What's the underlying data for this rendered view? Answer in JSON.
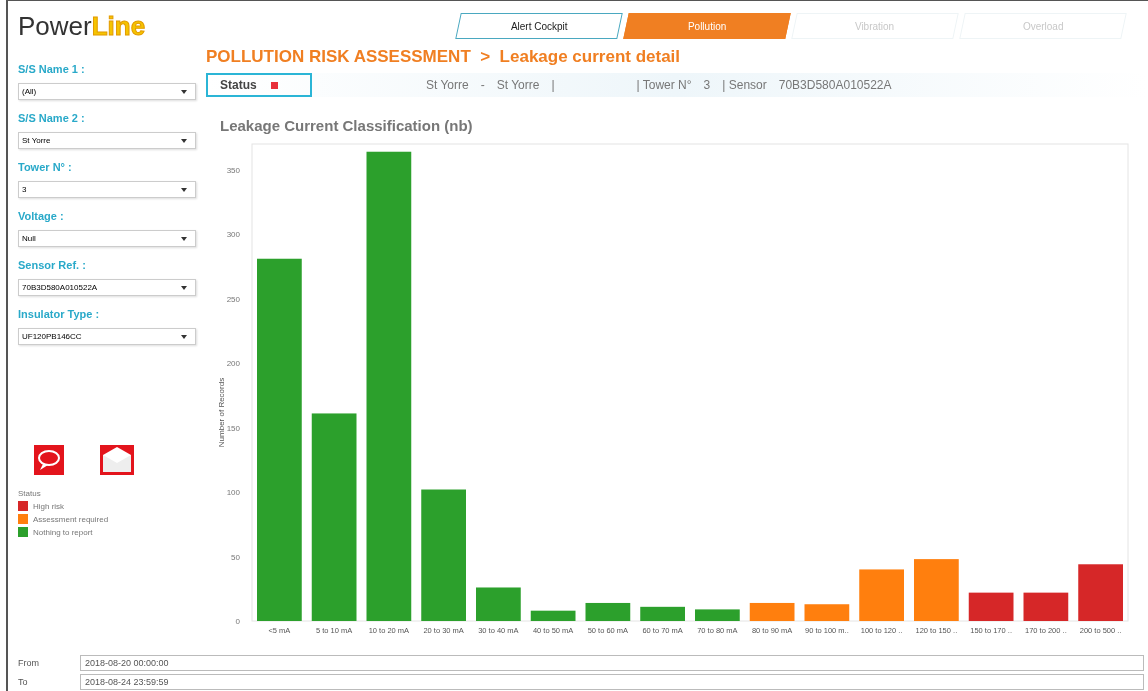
{
  "logo": {
    "part_1": "Power",
    "part_2": "Line"
  },
  "nav_tabs": [
    {
      "label": "Alert Cockpit",
      "selected": false,
      "disabled": false
    },
    {
      "label": "Pollution",
      "selected": true,
      "disabled": false
    },
    {
      "label": "Vibration",
      "selected": false,
      "disabled": true
    },
    {
      "label": "Overload",
      "selected": false,
      "disabled": true
    }
  ],
  "page_title": "POLLUTION RISK ASSESSMENT  >  Leakage current detail",
  "filters": [
    {
      "label": "S/S Name 1 :",
      "value": "(All)"
    },
    {
      "label": "S/S Name 2 :",
      "value": "St Yorre"
    },
    {
      "label": "Tower N° :",
      "value": "3"
    },
    {
      "label": "Voltage :",
      "value": "Null"
    },
    {
      "label": "Sensor Ref. :",
      "value": "70B3D580A010522A"
    },
    {
      "label": "Insulator Type :",
      "value": "UF120PB146CC"
    }
  ],
  "info_bar": {
    "status_label": "Status",
    "alert": true,
    "items": [
      "St Yorre",
      "-",
      "St Yorre",
      "|",
      "| Tower N°",
      "3",
      "| Sensor",
      "70B3D580A010522A"
    ]
  },
  "legend": {
    "title": "Status"
  },
  "chart": {
    "chart_data": {
      "type": "bar",
      "title": "Leakage Current Classification (nb)",
      "ylabel": "Number of Records",
      "stacked": true,
      "categories": [
        "<5 mA",
        "5 to 10 mA",
        "10 to 20 mA",
        "20 to 30 mA",
        "30 to 40 mA",
        "40 to 50 mA",
        "50 to 60 mA",
        "60 to 70 mA",
        "70 to 80 mA",
        "80 to 90 mA",
        "90 to 100 m..",
        "100 to 120 ..",
        "120 to 150 ..",
        "150 to 170 ..",
        "170 to 200 ..",
        "200 to 500 .."
      ],
      "ylim": [
        0,
        370
      ],
      "yticks": [
        0,
        50,
        100,
        150,
        200,
        250,
        300,
        350
      ],
      "series": [
        {
          "name": "Nothing to report",
          "color": "#2ca02c",
          "values": [
            281,
            161,
            364,
            102,
            26,
            8,
            14,
            11,
            9,
            null,
            null,
            null,
            null,
            null,
            null,
            null
          ]
        },
        {
          "name": "Assessment required",
          "color": "#ff7f0e",
          "values": [
            null,
            null,
            null,
            null,
            null,
            null,
            null,
            null,
            null,
            14,
            13,
            40,
            48,
            null,
            null,
            null
          ]
        },
        {
          "name": "High risk",
          "color": "#d62728",
          "values": [
            null,
            null,
            null,
            null,
            null,
            null,
            null,
            null,
            null,
            null,
            null,
            null,
            null,
            22,
            22,
            44
          ]
        }
      ]
    }
  },
  "date_range": [
    {
      "label": "From",
      "value": "2018-08-20 00:00:00"
    },
    {
      "label": "To",
      "value": "2018-08-24 23:59:59"
    }
  ]
}
